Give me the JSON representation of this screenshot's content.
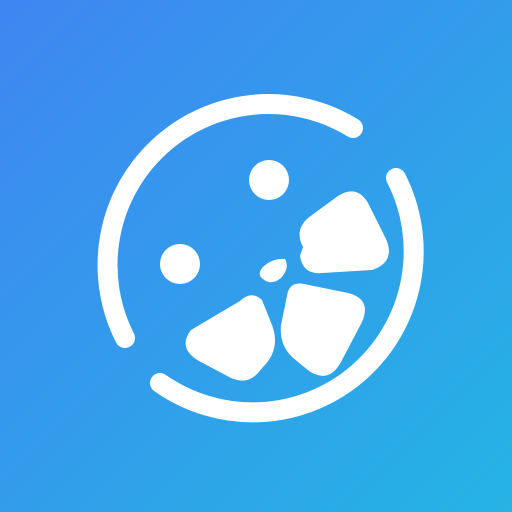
{
  "icon": {
    "name": "citrus-slice-icon",
    "background_gradient": [
      "#3F86F2",
      "#25B4E4"
    ],
    "foreground_color": "#FFFFFF"
  }
}
